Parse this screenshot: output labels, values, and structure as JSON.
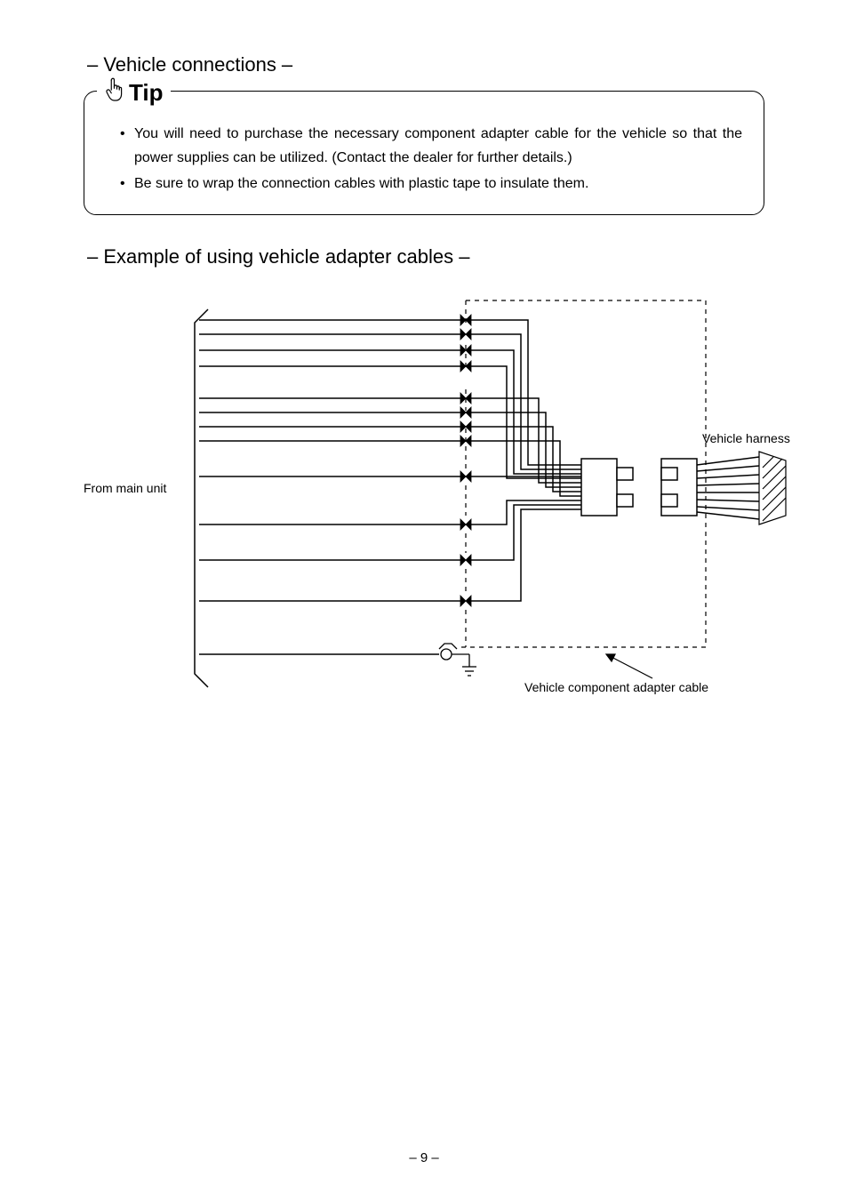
{
  "section1_title": "– Vehicle connections –",
  "tip_label": "Tip",
  "tips": [
    "You will need to purchase the necessary component adapter cable for the vehicle so that the power supplies can be utilized. (Contact the dealer for further details.)",
    "Be sure to wrap the connection cables with plastic tape to insulate them."
  ],
  "section2_title": "– Example of using vehicle adapter cables –",
  "diagram": {
    "left_label": "From main unit",
    "right_label": "Vehicle harness",
    "bottom_label": "Vehicle component adapter cable"
  },
  "page_number": "– 9 –"
}
